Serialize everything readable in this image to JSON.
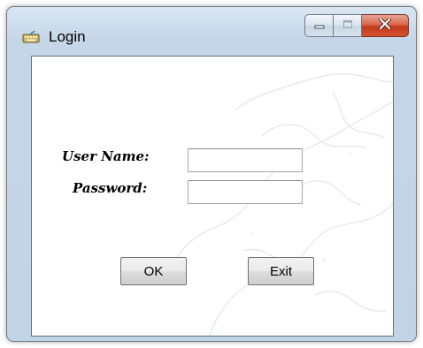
{
  "window": {
    "title": "Login",
    "icon": "keyboard-icon",
    "controls": {
      "minimize_icon": "minimize-icon",
      "maximize_icon": "maximize-icon",
      "close_icon": "close-icon"
    }
  },
  "form": {
    "username_label": "User Name:",
    "username_value": "",
    "password_label": "Password:",
    "password_value": ""
  },
  "buttons": {
    "ok_label": "OK",
    "exit_label": "Exit"
  },
  "background": {
    "image": "world-map-watermark"
  },
  "colors": {
    "close_button": "#c5391c",
    "window_frame": "#c2d3e4"
  }
}
